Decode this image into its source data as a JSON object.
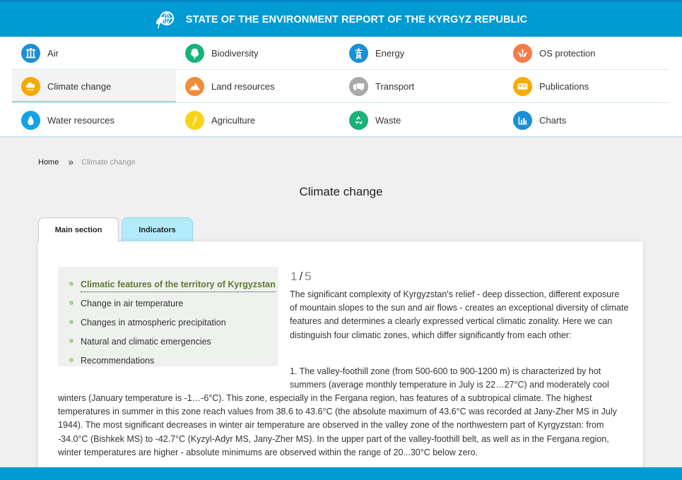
{
  "header": {
    "title": "STATE OF THE ENVIRONMENT REPORT OF THE KYRGYZ REPUBLIC",
    "logo_icon": "globe-leaf-icon"
  },
  "nav": {
    "rows": [
      [
        {
          "label": "Air",
          "icon": "air-icon",
          "color": "#1a8fd6"
        },
        {
          "label": "Biodiversity",
          "icon": "tree-icon",
          "color": "#19b37a"
        },
        {
          "label": "Energy",
          "icon": "power-tower-icon",
          "color": "#1a8fd6"
        },
        {
          "label": "OS protection",
          "icon": "hands-plant-icon",
          "color": "#f27d4a"
        }
      ],
      [
        {
          "label": "Climate change",
          "icon": "rain-cloud-icon",
          "color": "#f5a800",
          "active": true
        },
        {
          "label": "Land resources",
          "icon": "mountain-icon",
          "color": "#f28c38"
        },
        {
          "label": "Transport",
          "icon": "truck-icon",
          "color": "#a9a9a9"
        },
        {
          "label": "Publications",
          "icon": "publication-icon",
          "color": "#f9ab00"
        }
      ],
      [
        {
          "label": "Water resources",
          "icon": "water-drop-icon",
          "color": "#11a3e6"
        },
        {
          "label": "Agriculture",
          "icon": "wheat-icon",
          "color": "#f7d418"
        },
        {
          "label": "Waste",
          "icon": "recycle-icon",
          "color": "#19b37a"
        },
        {
          "label": "Charts",
          "icon": "bar-chart-icon",
          "color": "#1a8fd6"
        }
      ]
    ]
  },
  "breadcrumb": {
    "home": "Home",
    "separator": "»",
    "current": "Climate change"
  },
  "page_title": "Climate change",
  "tabs": [
    {
      "label": "Main section",
      "active": true
    },
    {
      "label": "Indicators",
      "active": false
    }
  ],
  "toc": [
    {
      "label": "Climatic features of the territory of Kyrgyzstan",
      "active": true
    },
    {
      "label": "Change in air temperature"
    },
    {
      "label": "Changes in atmospheric precipitation"
    },
    {
      "label": "Natural and climatic emergencies"
    },
    {
      "label": "Recommendations"
    }
  ],
  "pager": {
    "current": "1",
    "separator": "/",
    "total": "5"
  },
  "content": {
    "p1": "The significant complexity of Kyrgyzstan's relief - deep dissection, different exposure of mountain slopes to the sun and air flows - creates an exceptional diversity of climate features and determines a clearly expressed vertical climatic zonality. Here we can distinguish four climatic zones, which differ significantly from each other:",
    "p2_start": "1. The valley-foothill zone (from 500-600 to 900-1200 m) is characterized by hot summers (average monthly temperature in July is 22…27°C) and moderately cool",
    "p2_rest": "winters (January temperature is -1…-6°C). This zone, especially in the Fergana region, has features of a subtropical climate. The highest temperatures in summer in this zone reach values from 38.6 to 43.6°C (the absolute maximum of 43.6°C was recorded at Jany-Zher MS in July 1944). The most significant decreases in winter air temperature are observed in the valley zone of the northwestern part of Kyrgyzstan: from -34.0°C (Bishkek MS) to -42.7°C (Kyzyl-Adyr MS, Jany-Zher MS). In the upper part of the valley-foothill belt, as well as in the Fergana region, winter temperatures are higher - absolute minimums are observed within the range of 20...30°C below zero."
  },
  "colors": {
    "header": "#009bd2",
    "active_underline": "#9ed6cc",
    "toc_active": "#5d7a31",
    "tab_indicators": "#b3ebfb"
  }
}
